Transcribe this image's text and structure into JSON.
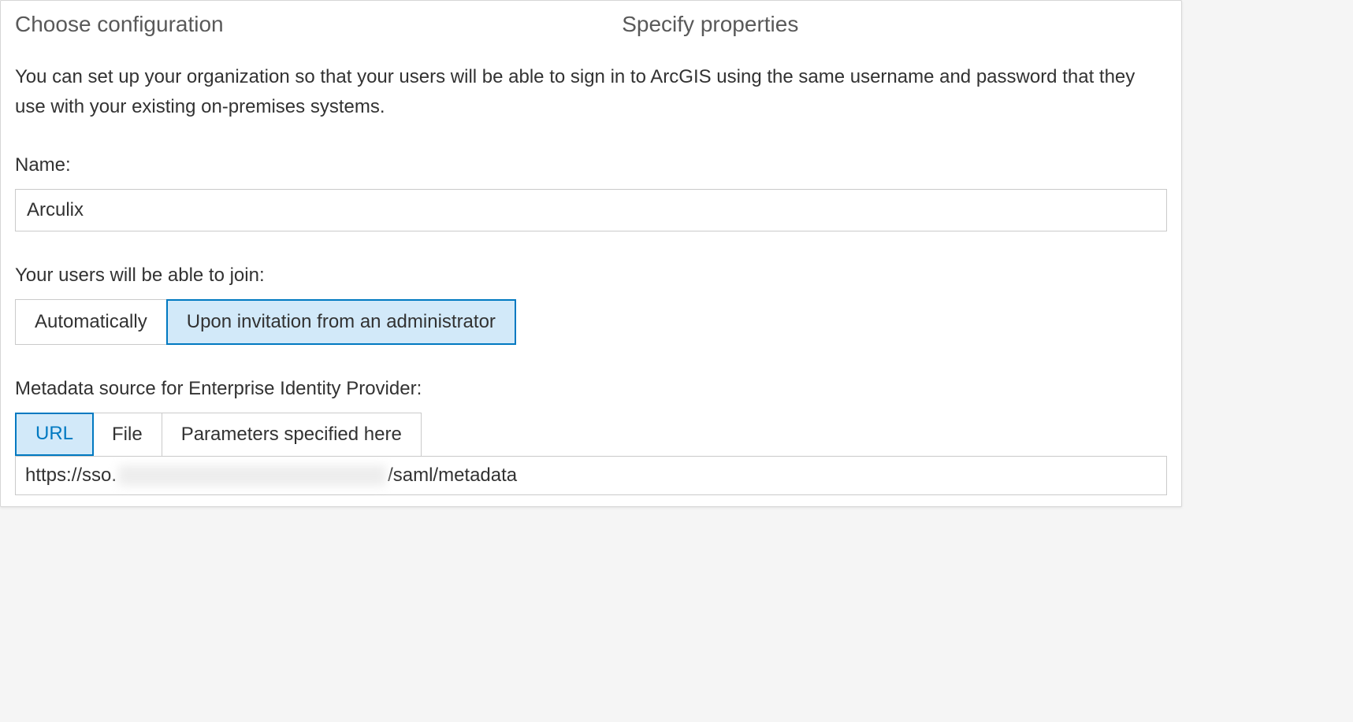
{
  "steps": {
    "choose": "Choose configuration",
    "specify": "Specify properties"
  },
  "intro": "You can set up your organization so that your users will be able to sign in to ArcGIS using the same username and password that they use with your existing on-premises systems.",
  "name": {
    "label": "Name:",
    "value": "Arculix"
  },
  "join": {
    "label": "Your users will be able to join:",
    "options": {
      "auto": "Automatically",
      "invite": "Upon invitation from an administrator"
    },
    "selected": "invite"
  },
  "metadata": {
    "label": "Metadata source for Enterprise Identity Provider:",
    "tabs": {
      "url": "URL",
      "file": "File",
      "params": "Parameters specified here"
    },
    "selected": "url",
    "url_prefix": "https://sso.",
    "url_suffix": "/saml/metadata"
  }
}
